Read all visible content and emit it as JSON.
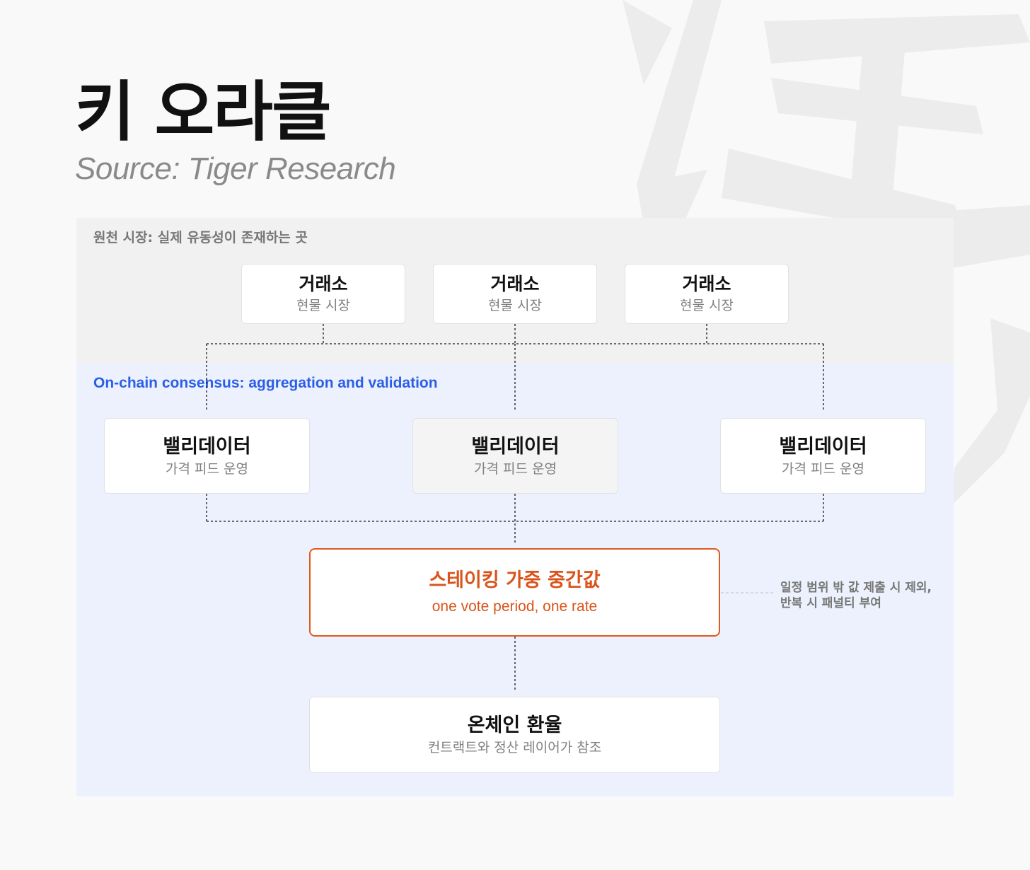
{
  "header": {
    "title": "키 오라클",
    "source": "Source: Tiger Research"
  },
  "zones": {
    "source_label": "원천 시장: 실제 유동성이 존재하는 곳",
    "chain_label": "On-chain consensus: aggregation and validation"
  },
  "exchanges": [
    {
      "title": "거래소",
      "sub": "현물 시장"
    },
    {
      "title": "거래소",
      "sub": "현물 시장"
    },
    {
      "title": "거래소",
      "sub": "현물 시장"
    }
  ],
  "validators": [
    {
      "title": "밸리데이터",
      "sub": "가격 피드 운영"
    },
    {
      "title": "밸리데이터",
      "sub": "가격 피드 운영"
    },
    {
      "title": "밸리데이터",
      "sub": "가격 피드 운영"
    }
  ],
  "median": {
    "title": "스테이킹 가중 중간값",
    "sub": "one vote period, one rate",
    "note_line1": "일정 범위 밖 값 제출 시 제외,",
    "note_line2": "반복 시 패널티 부여"
  },
  "rate": {
    "title": "온체인 환율",
    "sub": "컨트랙트와 정산 레이어가 참조"
  },
  "colors": {
    "accent_orange": "#e05a1b",
    "accent_blue": "#2b5ee8",
    "chain_zone_bg": "#ecf1fd",
    "source_zone_bg": "#f1f1f1"
  }
}
